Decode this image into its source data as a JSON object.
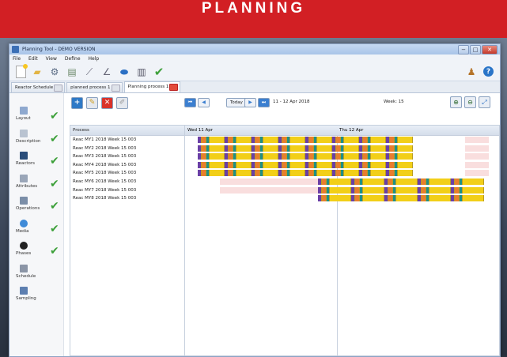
{
  "banner": {
    "title": "PLANNING"
  },
  "window": {
    "title": "Planning Tool - DEMO VERSION",
    "controls": {
      "minimize": "−",
      "maximize": "□",
      "close": "✕"
    }
  },
  "menu": [
    "File",
    "Edit",
    "View",
    "Define",
    "Help"
  ],
  "tabs": [
    {
      "label": "Reactor Schedule",
      "active": false
    },
    {
      "label": "planned process 1",
      "active": false
    },
    {
      "label": "Planning process 1",
      "active": true
    }
  ],
  "steps": [
    {
      "label": "Layout",
      "icon": "layout-icon",
      "done": true
    },
    {
      "label": "Description",
      "icon": "description-icon",
      "done": true
    },
    {
      "label": "Reactors",
      "icon": "reactors-icon",
      "done": true
    },
    {
      "label": "Attributes",
      "icon": "attributes-icon",
      "done": true
    },
    {
      "label": "Operations",
      "icon": "operations-icon",
      "done": true
    },
    {
      "label": "Media",
      "icon": "media-icon",
      "done": true
    },
    {
      "label": "Phases",
      "icon": "phases-icon",
      "done": true
    },
    {
      "label": "Schedule",
      "icon": "schedule-icon",
      "done": false
    },
    {
      "label": "Sampling",
      "icon": "sampling-icon",
      "done": false
    }
  ],
  "process_list": {
    "header": "Process",
    "rows": [
      "Reac MY1 2018 Week 15 003",
      "Reac MY2 2018 Week 15 003",
      "Reac MY3 2018 Week 15 003",
      "Reac MY4 2018 Week 15 003",
      "Reac MY5 2018 Week 15 003",
      "Reac MY6 2018 Week 15 003",
      "Reac MY7 2018 Week 15 003",
      "Reac MY8 2018 Week 15 003"
    ]
  },
  "gantt": {
    "today_label": "Today",
    "date_range": "11 - 12 Apr 2018",
    "week": "Week: 15",
    "days": [
      "Wed 11 Apr",
      "Thu 12 Apr"
    ],
    "colors": {
      "purple": "#6a3fa6",
      "orange": "#e87e2d",
      "teal": "#1f8f86",
      "yellow": "#f2cf18",
      "pink": "#f9dede"
    }
  }
}
